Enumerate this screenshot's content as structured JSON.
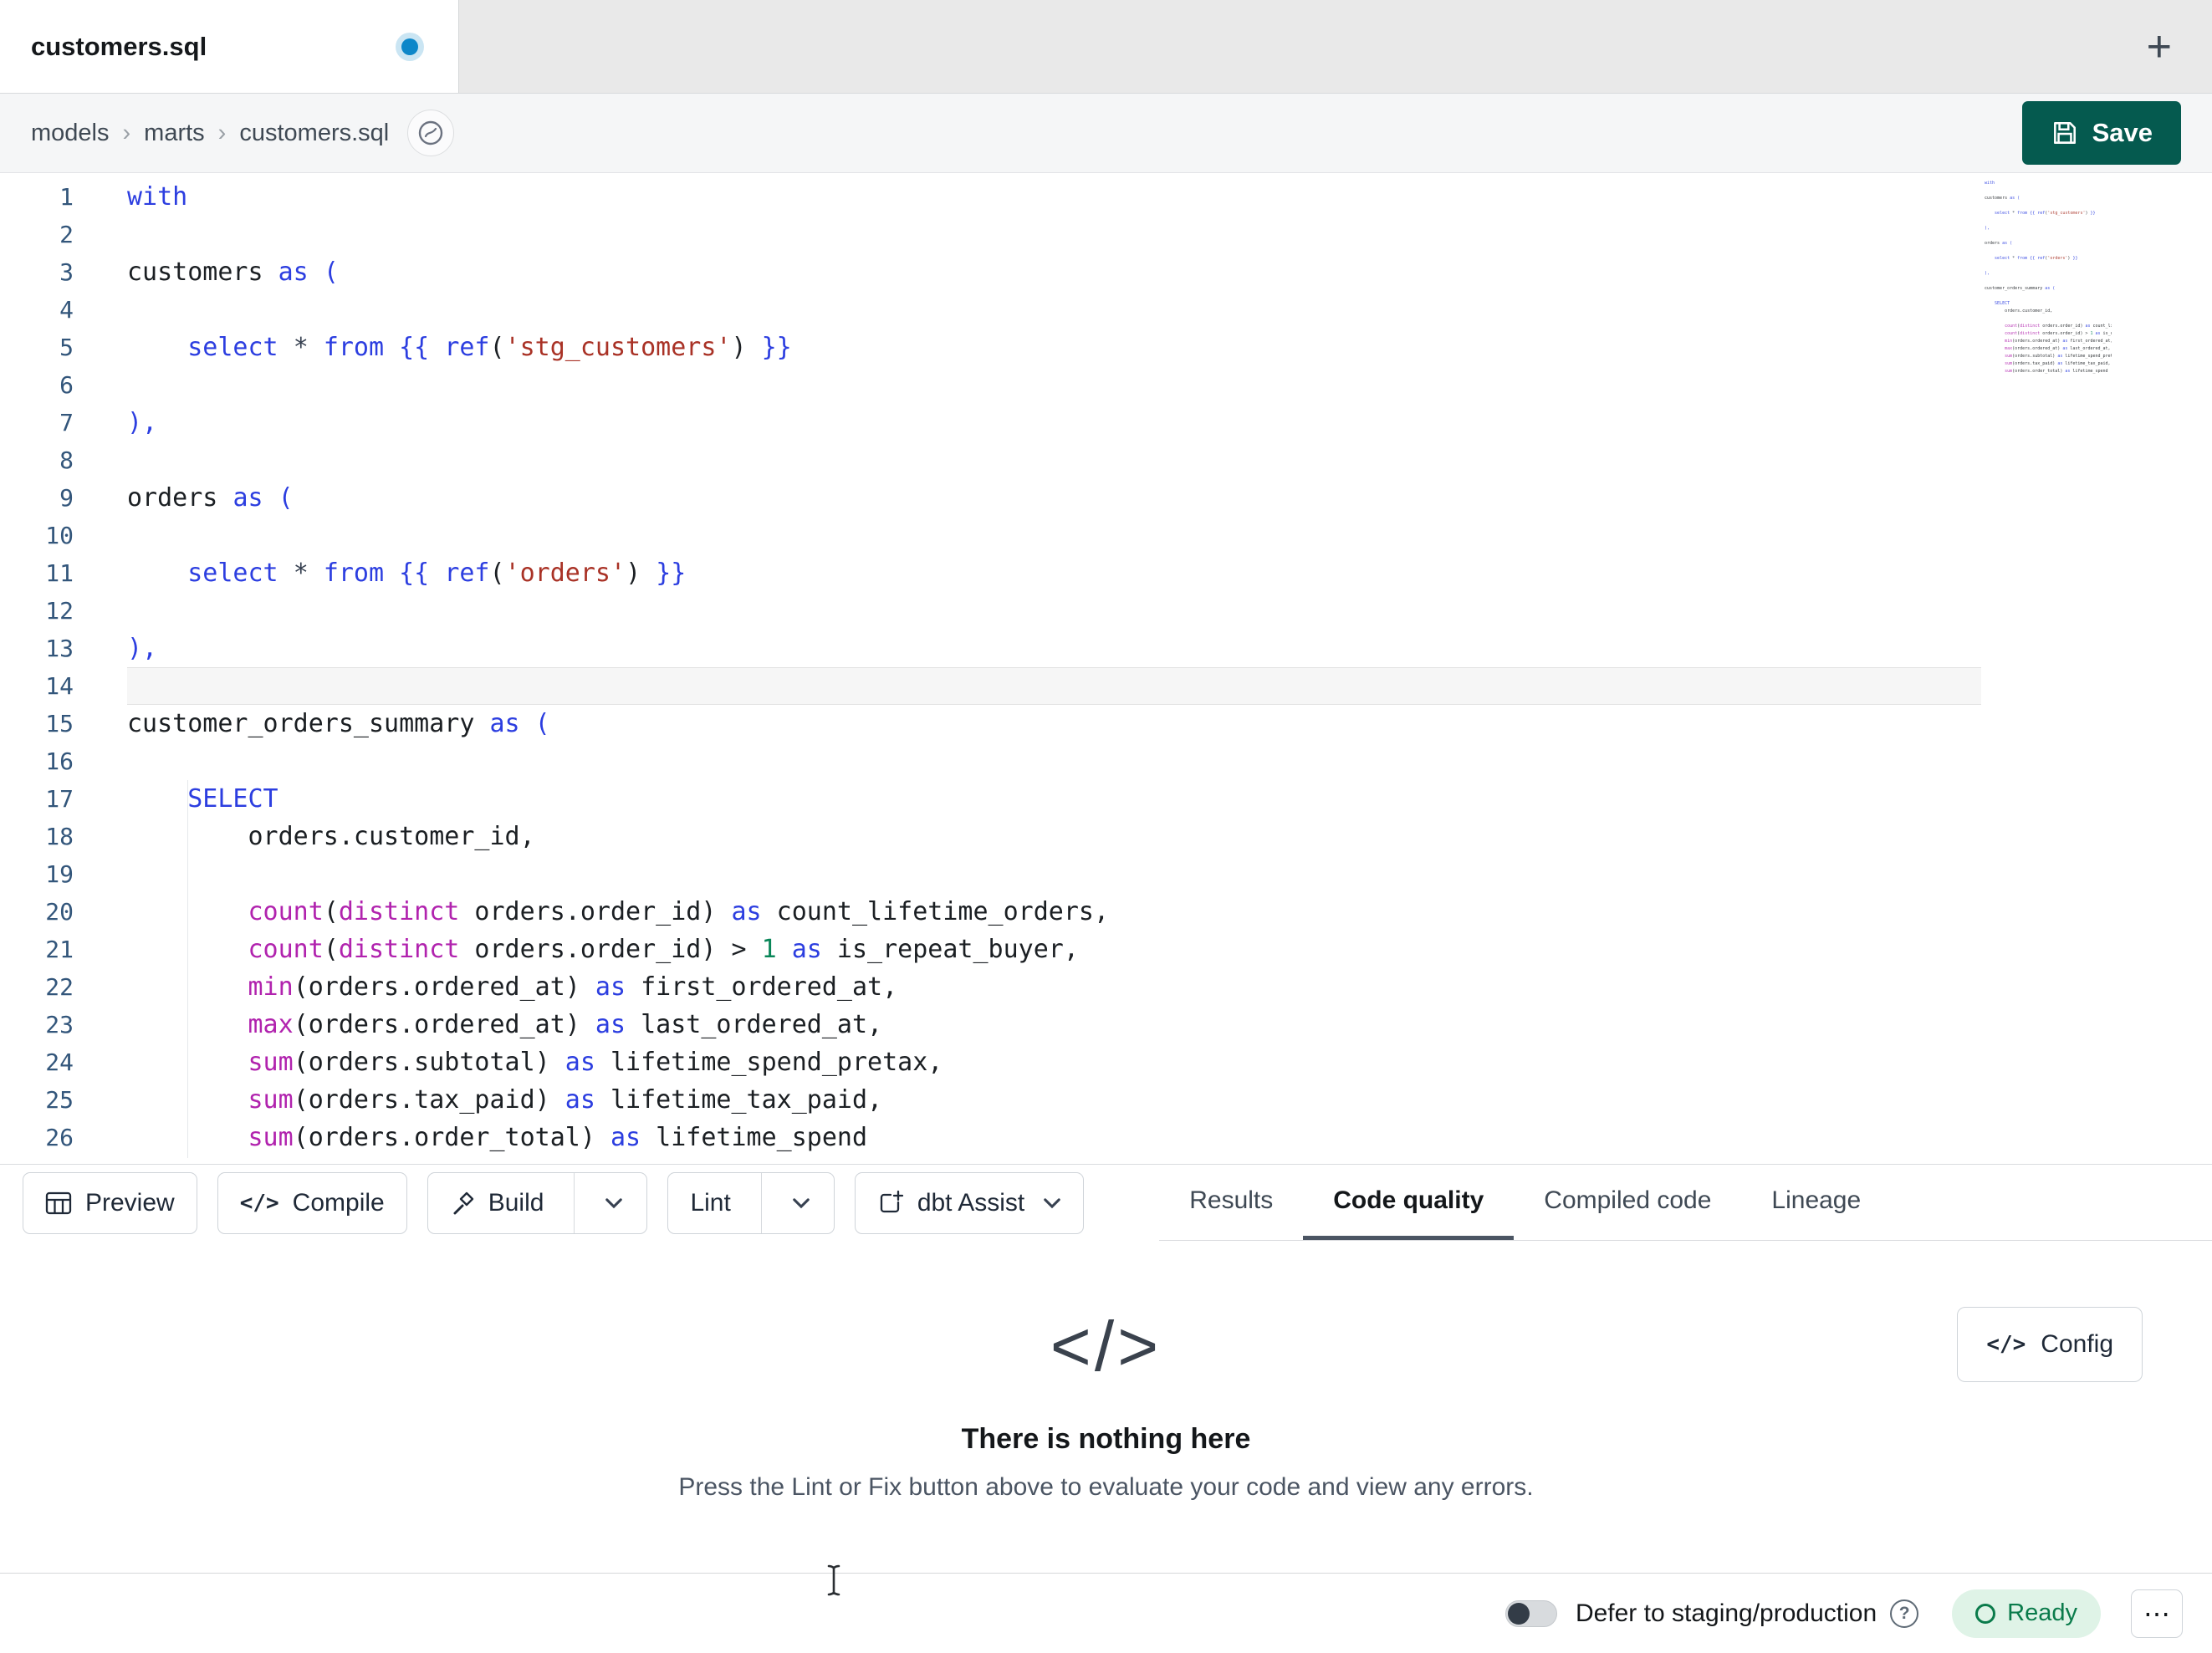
{
  "colors": {
    "save_button": "#055a4f",
    "ready_bg": "#dff3e7",
    "ready_text": "#0a7b4b",
    "unsaved_dot": "#0d87c9",
    "syntax_keyword": "#2c3ee0",
    "syntax_function": "#b123ae",
    "syntax_string": "#a93226",
    "syntax_number": "#098658",
    "active_tab_underline": "#4b5563"
  },
  "tab_bar": {
    "active_tab": "customers.sql",
    "new_tab_glyph": "+"
  },
  "breadcrumb": {
    "items": [
      "models",
      "marts",
      "customers.sql"
    ],
    "separator": "›"
  },
  "save": {
    "label": "Save"
  },
  "editor": {
    "lines": [
      {
        "n": 1,
        "toks": [
          [
            "with",
            "k"
          ]
        ]
      },
      {
        "n": 2,
        "toks": []
      },
      {
        "n": 3,
        "toks": [
          [
            "customers ",
            "d"
          ],
          [
            "as",
            "k"
          ],
          [
            " ",
            "d"
          ],
          [
            "(",
            "k"
          ]
        ]
      },
      {
        "n": 4,
        "toks": []
      },
      {
        "n": 5,
        "toks": [
          [
            "    ",
            "d"
          ],
          [
            "select",
            "k"
          ],
          [
            " ",
            "d"
          ],
          [
            "*",
            "o"
          ],
          [
            " ",
            "d"
          ],
          [
            "from",
            "k"
          ],
          [
            " ",
            "d"
          ],
          [
            "{{",
            "k"
          ],
          [
            " ",
            "d"
          ],
          [
            "ref",
            "k"
          ],
          [
            "(",
            "d"
          ],
          [
            "'stg_customers'",
            "s"
          ],
          [
            ")",
            "d"
          ],
          [
            " ",
            "d"
          ],
          [
            "}}",
            "k"
          ]
        ]
      },
      {
        "n": 6,
        "toks": []
      },
      {
        "n": 7,
        "toks": [
          [
            "),",
            "k"
          ]
        ]
      },
      {
        "n": 8,
        "toks": []
      },
      {
        "n": 9,
        "toks": [
          [
            "orders ",
            "d"
          ],
          [
            "as",
            "k"
          ],
          [
            " ",
            "d"
          ],
          [
            "(",
            "k"
          ]
        ]
      },
      {
        "n": 10,
        "toks": []
      },
      {
        "n": 11,
        "toks": [
          [
            "    ",
            "d"
          ],
          [
            "select",
            "k"
          ],
          [
            " ",
            "d"
          ],
          [
            "*",
            "o"
          ],
          [
            " ",
            "d"
          ],
          [
            "from",
            "k"
          ],
          [
            " ",
            "d"
          ],
          [
            "{{",
            "k"
          ],
          [
            " ",
            "d"
          ],
          [
            "ref",
            "k"
          ],
          [
            "(",
            "d"
          ],
          [
            "'orders'",
            "s"
          ],
          [
            ")",
            "d"
          ],
          [
            " ",
            "d"
          ],
          [
            "}}",
            "k"
          ]
        ]
      },
      {
        "n": 12,
        "toks": []
      },
      {
        "n": 13,
        "toks": [
          [
            "),",
            "k"
          ]
        ]
      },
      {
        "n": 14,
        "toks": [],
        "active": true
      },
      {
        "n": 15,
        "toks": [
          [
            "customer_orders_summary ",
            "d"
          ],
          [
            "as",
            "k"
          ],
          [
            " ",
            "d"
          ],
          [
            "(",
            "k"
          ]
        ]
      },
      {
        "n": 16,
        "toks": []
      },
      {
        "n": 17,
        "toks": [
          [
            "    ",
            "d"
          ],
          [
            "SELECT",
            "k"
          ]
        ]
      },
      {
        "n": 18,
        "toks": [
          [
            "        orders.customer_id,",
            "d"
          ]
        ]
      },
      {
        "n": 19,
        "toks": []
      },
      {
        "n": 20,
        "toks": [
          [
            "        ",
            "d"
          ],
          [
            "count",
            "f"
          ],
          [
            "(",
            "d"
          ],
          [
            "distinct",
            "f"
          ],
          [
            " orders.order_id",
            "d"
          ],
          [
            ") ",
            "d"
          ],
          [
            "as",
            "k"
          ],
          [
            " count_lifetime_orders,",
            "d"
          ]
        ]
      },
      {
        "n": 21,
        "toks": [
          [
            "        ",
            "d"
          ],
          [
            "count",
            "f"
          ],
          [
            "(",
            "d"
          ],
          [
            "distinct",
            "f"
          ],
          [
            " orders.order_id",
            "d"
          ],
          [
            ") > ",
            "d"
          ],
          [
            "1",
            "n"
          ],
          [
            " ",
            "d"
          ],
          [
            "as",
            "k"
          ],
          [
            " is_repeat_buyer,",
            "d"
          ]
        ]
      },
      {
        "n": 22,
        "toks": [
          [
            "        ",
            "d"
          ],
          [
            "min",
            "f"
          ],
          [
            "(orders.ordered_at) ",
            "d"
          ],
          [
            "as",
            "k"
          ],
          [
            " first_ordered_at,",
            "d"
          ]
        ]
      },
      {
        "n": 23,
        "toks": [
          [
            "        ",
            "d"
          ],
          [
            "max",
            "f"
          ],
          [
            "(orders.ordered_at) ",
            "d"
          ],
          [
            "as",
            "k"
          ],
          [
            " last_ordered_at,",
            "d"
          ]
        ]
      },
      {
        "n": 24,
        "toks": [
          [
            "        ",
            "d"
          ],
          [
            "sum",
            "f"
          ],
          [
            "(orders.subtotal) ",
            "d"
          ],
          [
            "as",
            "k"
          ],
          [
            " lifetime_spend_pretax,",
            "d"
          ]
        ]
      },
      {
        "n": 25,
        "toks": [
          [
            "        ",
            "d"
          ],
          [
            "sum",
            "f"
          ],
          [
            "(orders.tax_paid) ",
            "d"
          ],
          [
            "as",
            "k"
          ],
          [
            " lifetime_tax_paid,",
            "d"
          ]
        ]
      },
      {
        "n": 26,
        "toks": [
          [
            "        ",
            "d"
          ],
          [
            "sum",
            "f"
          ],
          [
            "(orders.order_total) ",
            "d"
          ],
          [
            "as",
            "k"
          ],
          [
            " lifetime_spend",
            "d"
          ]
        ]
      }
    ]
  },
  "action_bar": {
    "buttons": [
      {
        "label": "Preview"
      },
      {
        "label": "Compile"
      },
      {
        "label": "Build"
      },
      {
        "label": "Lint"
      },
      {
        "label": "dbt Assist"
      }
    ],
    "tabs": [
      {
        "label": "Results"
      },
      {
        "label": "Code quality",
        "active": true
      },
      {
        "label": "Compiled code"
      },
      {
        "label": "Lineage"
      }
    ]
  },
  "empty_state": {
    "icon_glyph": "</>",
    "title": "There is nothing here",
    "subtitle": "Press the Lint or Fix button above to evaluate your code and view any errors.",
    "config_label": "Config"
  },
  "status_bar": {
    "defer_label": "Defer to staging/production",
    "help_glyph": "?",
    "ready_label": "Ready",
    "more_glyph": "⋯"
  },
  "icons": {
    "code_glyph": "</>"
  }
}
